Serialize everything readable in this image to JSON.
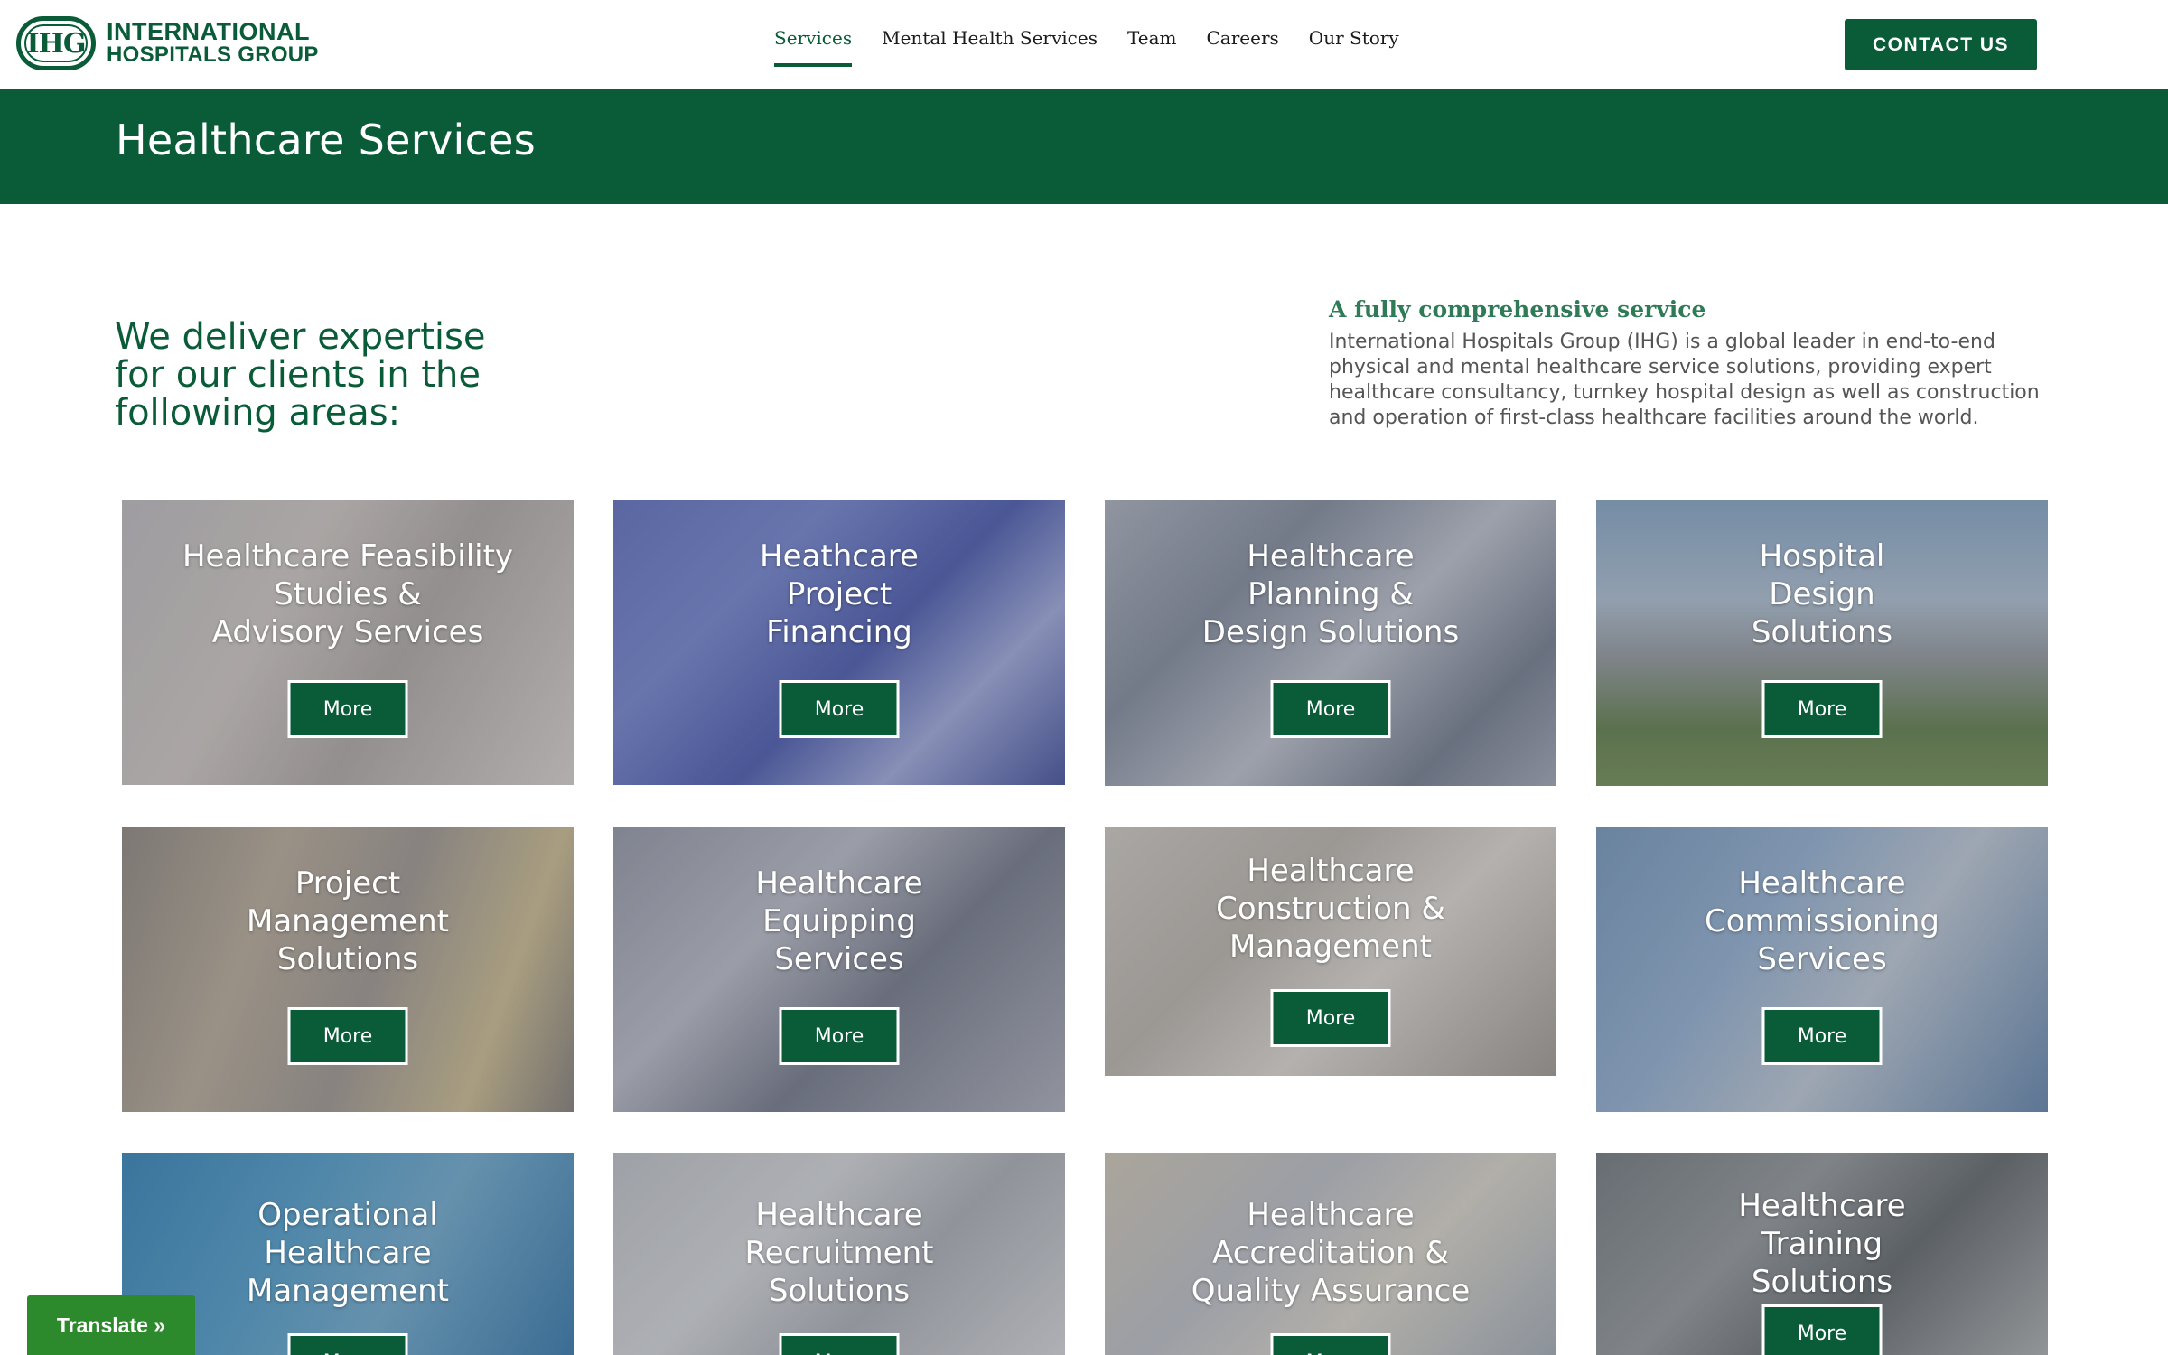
{
  "logo": {
    "mark": "IHG",
    "line1": "INTERNATIONAL",
    "line2": "HOSPITALS GROUP"
  },
  "nav": [
    {
      "label": "Services",
      "active": true
    },
    {
      "label": "Mental Health Services"
    },
    {
      "label": "Team"
    },
    {
      "label": "Careers"
    },
    {
      "label": "Our Story"
    }
  ],
  "contact_label": "CONTACT US",
  "banner": {
    "title": "Healthcare Services"
  },
  "intro": {
    "heading": "We deliver expertise for our clients in the following areas:",
    "subheading": "A fully comprehensive service",
    "body": "International Hospitals Group (IHG) is a global leader in end-to-end physical and mental healthcare service solutions, providing expert healthcare consultancy, turnkey hospital design as well as construction and operation of first-class healthcare facilities around the world."
  },
  "services": [
    {
      "title": [
        "Healthcare Feasibility",
        "Studies &",
        "Advisory Services"
      ],
      "more": "More"
    },
    {
      "title": [
        "Heathcare",
        "Project",
        "Financing"
      ],
      "more": "More"
    },
    {
      "title": [
        "Healthcare",
        "Planning &",
        "Design Solutions"
      ],
      "more": "More"
    },
    {
      "title": [
        "Hospital",
        "Design",
        "Solutions"
      ],
      "more": "More"
    },
    {
      "title": [
        "Project",
        "Management",
        "Solutions"
      ],
      "more": "More"
    },
    {
      "title": [
        "Healthcare",
        "Equipping",
        "Services"
      ],
      "more": "More"
    },
    {
      "title": [
        "Healthcare",
        "Construction &",
        "Management"
      ],
      "more": "More"
    },
    {
      "title": [
        "Healthcare",
        "Commissioning",
        "Services"
      ],
      "more": "More"
    },
    {
      "title": [
        "Operational",
        "Healthcare",
        "Management"
      ],
      "more": "More"
    },
    {
      "title": [
        "Healthcare",
        "Recruitment",
        "Solutions"
      ],
      "more": "More"
    },
    {
      "title": [
        "Healthcare",
        "Accreditation &",
        "Quality Assurance"
      ],
      "more": "More"
    },
    {
      "title": [
        "Healthcare",
        "Training",
        "Solutions"
      ],
      "more": "More"
    }
  ],
  "translate_label": "Translate »",
  "colors": {
    "brand_green": "#0a5b38",
    "translate_green": "#2c8a2c"
  }
}
